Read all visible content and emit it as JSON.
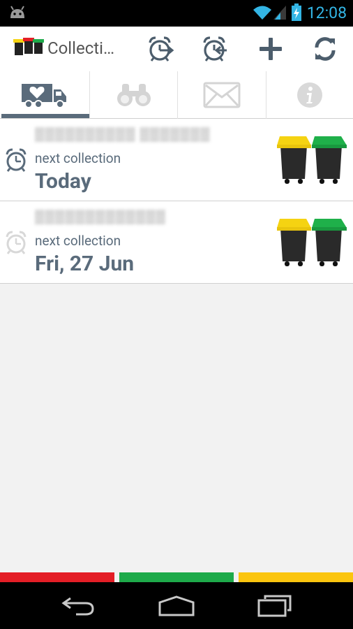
{
  "status_bar": {
    "time": "12:08",
    "icons": [
      "android-icon",
      "wifi-icon",
      "signal-icon",
      "battery-charging-icon"
    ],
    "accent_color": "#33b5e5"
  },
  "action_bar": {
    "title": "Collecti…",
    "actions": [
      "alarm-forward-icon",
      "alarm-back-icon",
      "add-icon",
      "refresh-icon"
    ]
  },
  "tabs": [
    {
      "name": "collection-truck-icon",
      "selected": true
    },
    {
      "name": "binoculars-icon",
      "selected": false
    },
    {
      "name": "envelope-icon",
      "selected": false
    },
    {
      "name": "info-icon",
      "selected": false
    }
  ],
  "collections": [
    {
      "address": "▒▒▒▒▒▒▒▒▒▒ ▒▒▒▒▒▒▒",
      "label": "next collection",
      "date": "Today",
      "alarm_active": true,
      "bins": [
        "yellow",
        "green"
      ]
    },
    {
      "address": "▒▒▒▒▒▒▒▒▒▒▒▒▒",
      "label": "next collection",
      "date": "Fri, 27 Jun",
      "alarm_active": false,
      "bins": [
        "yellow",
        "green"
      ]
    }
  ],
  "colors": {
    "text_primary": "#5a6b7b",
    "strip_red": "#e41e26",
    "strip_green": "#1eaa4a",
    "strip_yellow": "#fbc50f",
    "bin_yellow": "#f5d312",
    "bin_green": "#1fb04a"
  },
  "navigation": [
    "back-icon",
    "home-icon",
    "recent-apps-icon"
  ]
}
